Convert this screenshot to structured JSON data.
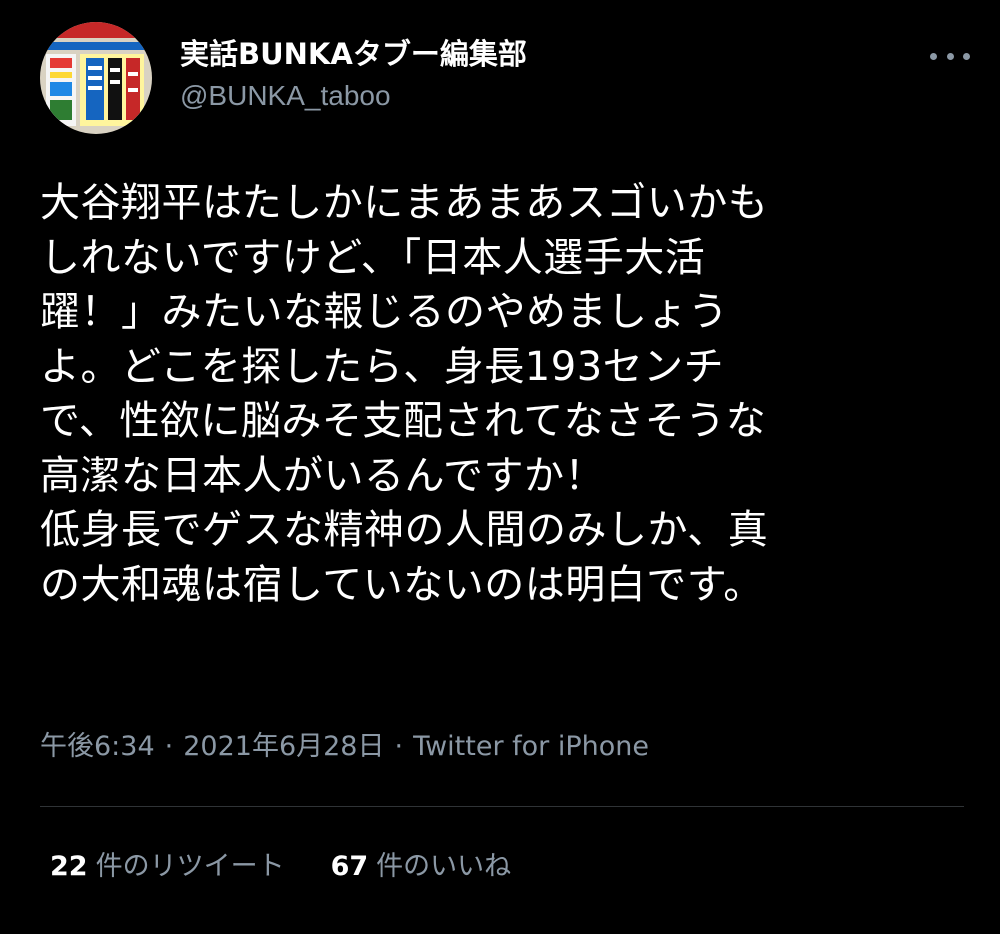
{
  "author": {
    "display_name": "実話BUNKAタブー編集部",
    "handle": "@BUNKA_taboo",
    "avatar_icon": "magazine-cover-avatar"
  },
  "tweet": {
    "lines": [
      "大谷翔平はたしかにまあまあスゴいかも",
      "しれないですけど、「日本人選手大活",
      "躍！」みたいな報じるのやめましょう",
      "よ。どこを探したら、身長193センチ",
      "で、性欲に脳みそ支配されてなさそうな",
      "高潔な日本人がいるんですか！",
      "低身長でゲスな精神の人間のみしか、真",
      "の大和魂は宿していないのは明白です。"
    ]
  },
  "meta": {
    "time": "午後6:34",
    "separator": "·",
    "date": "2021年6月28日",
    "source": "Twitter for iPhone"
  },
  "stats": {
    "retweets_count": "22",
    "retweets_label": "件のリツイート",
    "likes_count": "67",
    "likes_label": "件のいいね"
  },
  "colors": {
    "background": "#000000",
    "primary_text": "#ffffff",
    "secondary_text": "#8b98a5",
    "divider": "#2f3336"
  }
}
